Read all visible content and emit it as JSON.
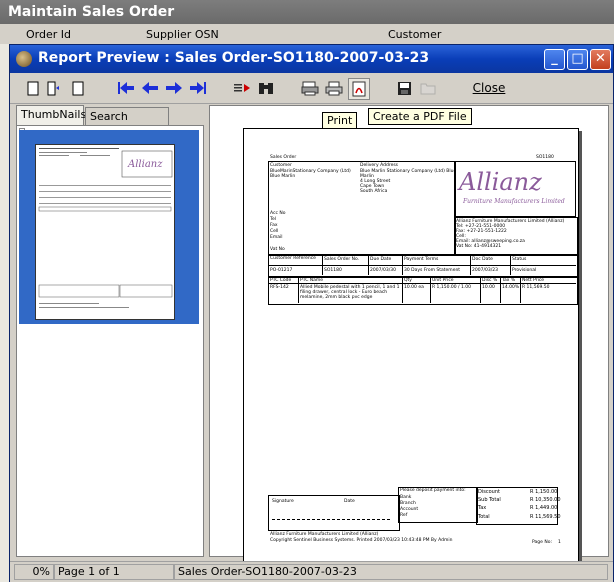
{
  "background_app": {
    "title": "Maintain Sales Order",
    "columns": [
      "Order Id",
      "Supplier OSN",
      "Customer"
    ]
  },
  "window": {
    "title": "Report Preview : Sales Order-SO1180-2007-03-23",
    "controls": {
      "minimize": "_",
      "maximize": "□",
      "close": "✕"
    }
  },
  "toolbar": {
    "close_label": "Close",
    "tooltips": {
      "print": "Print",
      "pdf": "Create a PDF File"
    }
  },
  "tabs": [
    {
      "label": "ThumbNails"
    },
    {
      "label": "Search Results"
    }
  ],
  "document": {
    "title": "Sales Order",
    "number": "SO1180",
    "customer_label": "Customer",
    "customer_name": "BlueMarinStationary Company (Ltd) Blue Marlin",
    "delivery_label": "Delivery Address",
    "delivery_lines": [
      "Blue Marlin Stationary Company (Ltd) Blue",
      "Marlin",
      "4 Long Street",
      "Cape Town",
      "South Africa"
    ],
    "contact_labels": [
      "Acc No",
      "Tel",
      "Fax",
      "Cell",
      "Email",
      "Vat No"
    ],
    "logo_text": "Allianz",
    "logo_sub": "Furniture Manufacturers Limited",
    "supplier_lines": [
      "Allianz Furniture Manufacturers Limited (Allianz)",
      "Tel: +27-21-551-0000",
      "Fax: +27-21-551-1222",
      "Cell:",
      "Email: allianz@sweeping.co.za",
      "Vat No: 41-4914321"
    ],
    "info_headers": [
      "Customer Reference",
      "Sales Order No.",
      "Due Date",
      "Payment Terms",
      "Doc Date",
      "Status"
    ],
    "info_values": [
      "PO-01217",
      "SO1180",
      "2007/03/30",
      "30 Days From Statement",
      "2007/03/23",
      "Provisional"
    ],
    "item_headers": [
      "PTC Code",
      "PTC Name",
      "Qty",
      "Unit Price",
      "Disc %",
      "Tax %",
      "Nett Price"
    ],
    "item_row": [
      "RFS-142",
      "Allied Mobile pedestal with 1 pencil, 1 and 1 filing drawer, central lock - Euro beach melamine, 2mm black pvc edge",
      "10.00 ea",
      "R 1,150.00 / 1.00",
      "10.00",
      "14.00%",
      "R 11,569.50"
    ],
    "signature_label": "Signature",
    "date_label": "Date",
    "bank_title": "Please deposit payment into:",
    "bank_lines": [
      "Bank",
      "Branch",
      "Account",
      "Ref"
    ],
    "totals": [
      {
        "label": "Discount",
        "value": "R 1,150.00"
      },
      {
        "label": "Sub Total",
        "value": "R 10,350.00"
      },
      {
        "label": "Tax",
        "value": "R 1,449.00"
      },
      {
        "label": "Total",
        "value": "R 11,569.50"
      }
    ],
    "footer_1": "Allianz Furniture Manufacturers Limited (Allianz)",
    "footer_2": "Copyright Sentinel Business Systems. Printed 2007/03/23 10:43:48 PM By Admin",
    "page_label": "Page No:",
    "page_num": "1"
  },
  "status": {
    "zoom": "0%",
    "page": "Page 1 of 1",
    "doc": "Sales Order-SO1180-2007-03-23"
  }
}
